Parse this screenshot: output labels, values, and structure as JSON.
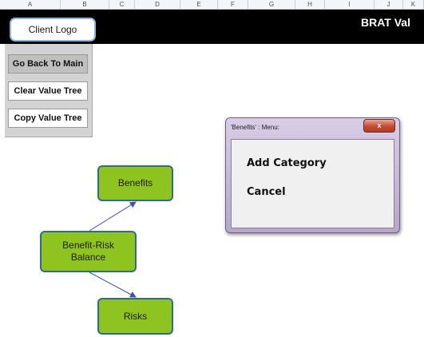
{
  "spreadsheet": {
    "columns": [
      "A",
      "B",
      "C",
      "D",
      "E",
      "F",
      "G",
      "H",
      "I",
      "J",
      "K"
    ]
  },
  "header": {
    "client_logo_label": "Client Logo",
    "app_title": "BRAT Val"
  },
  "sidebar_buttons": {
    "go_back": "Go Back To Main",
    "clear_tree": "Clear Value Tree",
    "copy_tree": "Copy Value Tree"
  },
  "value_tree": {
    "benefits": "Benefits",
    "balance_line1": "Benefit-Risk",
    "balance_line2": "Balance",
    "risks": "Risks"
  },
  "menu_dialog": {
    "title": "'Benefits' : Menu:",
    "close_glyph": "x",
    "items": [
      "Add Category",
      "Cancel"
    ]
  },
  "colors": {
    "title_band": "#000000",
    "node_fill": "#8fc31f",
    "node_border": "#2f6d8e",
    "connector": "#3b4fb0",
    "dialog_frame": "#c8b8dc",
    "close_button": "#c44a34"
  }
}
